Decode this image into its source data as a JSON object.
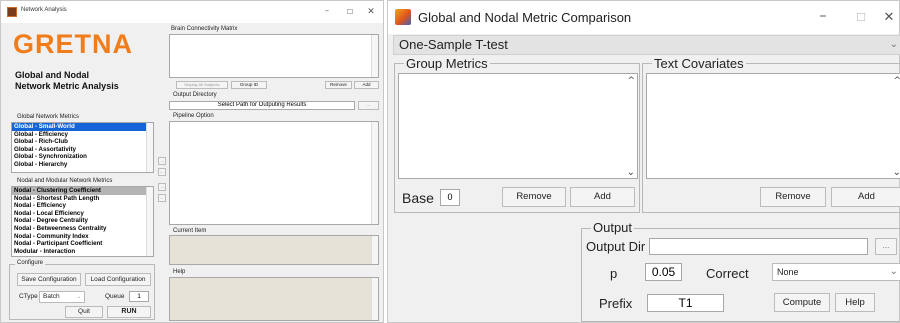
{
  "left": {
    "title": "Network Analysis",
    "logo": "GRETNA",
    "subtitle_1": "Global and Nodal",
    "subtitle_2": "Network Metric Analysis",
    "global_label": "Global Network Metrics",
    "global_items": [
      "Global - Small-World",
      "Global - Efficiency",
      "Global - Rich-Club",
      "Global - Assortativity",
      "Global - Synchronization",
      "Global - Hierarchy"
    ],
    "nodal_label": "Nodal and Modular Network Metrics",
    "nodal_items": [
      "Nodal - Clustering Coefficient",
      "Nodal - Shortest Path Length",
      "Nodal - Efficiency",
      "Nodal - Local Efficiency",
      "Nodal - Degree Centrality",
      "Nodal - Betweenness Centrality",
      "Nodal - Community Index",
      "Nodal - Participant Coefficient",
      "Modular - Interaction"
    ],
    "configure_label": "Configure",
    "save_config": "Save Configuration",
    "load_config": "Load Configuration",
    "ctype_label": "CType",
    "ctype_value": "Batch",
    "queue_label": "Queue",
    "queue_value": "1",
    "quit": "Quit",
    "run": "RUN",
    "matrix_label": "Brain Connectivity Matrix",
    "display_all": "Display All Subjects",
    "group_id": "Group ID",
    "remove": "Remove",
    "add": "Add",
    "output_label": "Output Directory",
    "output_placeholder": "Select Path for Outputing Results",
    "output_btn": "...",
    "pipeline_label": "Pipeline Option",
    "current_label": "Current Item",
    "help_label": "Help"
  },
  "right": {
    "title": "Global and Nodal Metric Comparison",
    "test_type": "One-Sample T-test",
    "group_metrics_label": "Group Metrics",
    "text_covariates_label": "Text Covariates",
    "base_label": "Base",
    "base_value": "0",
    "remove": "Remove",
    "add": "Add",
    "cov_remove": "Remove",
    "cov_add": "Add",
    "output_label": "Output",
    "output_dir_label": "Output Dir",
    "output_dir_value": "",
    "browse": "...",
    "p_label": "p",
    "p_value": "0.05",
    "correct_label": "Correct",
    "correct_value": "None",
    "prefix_label": "Prefix",
    "prefix_value": "T1",
    "compute": "Compute",
    "help": "Help"
  },
  "icons": {
    "minimize": "minimize-icon",
    "maximize": "maximize-icon",
    "close": "close-icon",
    "app": "matlab-icon"
  },
  "colors": {
    "logo": "#f07d1a",
    "selected": "#1464d8",
    "window_bg": "#f0f0f0"
  }
}
